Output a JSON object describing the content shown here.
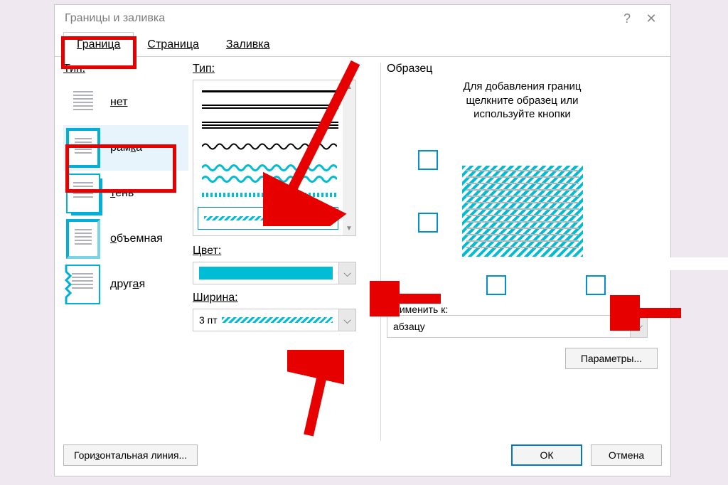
{
  "dialog": {
    "title": "Границы и заливка"
  },
  "tabs": {
    "border": "Граница",
    "page": "Страница",
    "shading": "Заливка"
  },
  "col1": {
    "label": "Тип:",
    "settings": {
      "none": "нет",
      "box": "рамка",
      "shadow": "тень",
      "threed": "объемная",
      "custom": "другая"
    }
  },
  "col2": {
    "style_label": "Тип:",
    "color_label": "Цвет:",
    "width_label": "Ширина:",
    "width_value": "3 пт"
  },
  "col3": {
    "preview_label": "Образец",
    "preview_hint_line1": "Для добавления границ",
    "preview_hint_line2": "щелкните образец или",
    "preview_hint_line3": "используйте кнопки",
    "apply_label": "Применить к:",
    "apply_value": "абзацу",
    "options_btn": "Параметры..."
  },
  "footer": {
    "hline": "Горизонтальная линия...",
    "ok": "ОК",
    "cancel": "Отмена"
  },
  "accent_color": "#00bcd4"
}
